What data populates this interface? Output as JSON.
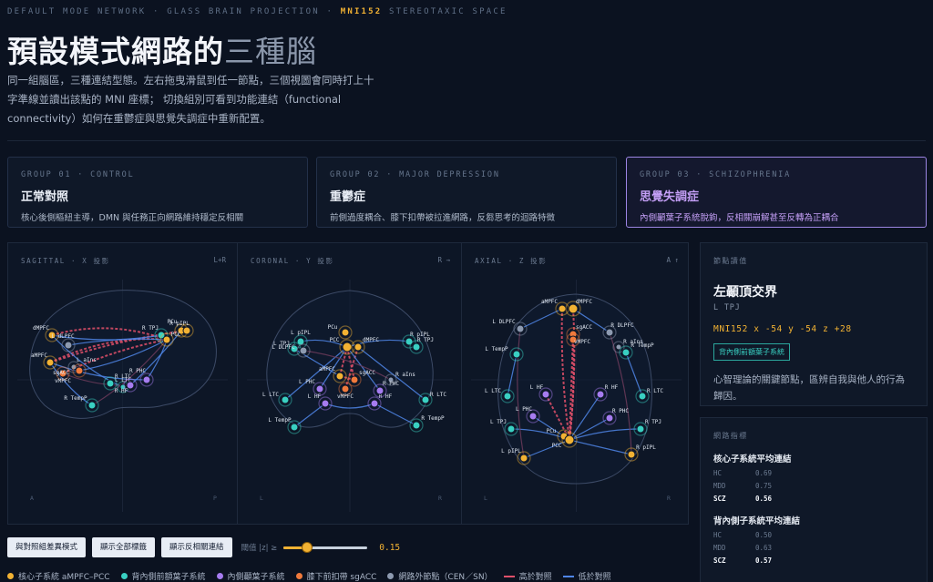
{
  "header": {
    "eyebrow_a": "DEFAULT MODE NETWORK · GLASS BRAIN PROJECTION ·",
    "eyebrow_hl": "MNI152",
    "eyebrow_b": "STEREOTAXIC SPACE",
    "title_strong": "預設模式網路的",
    "title_thin": "三種腦",
    "lede": "同一組腦區，三種連結型態。左右拖曳滑鼠到任一節點，三個視圖會同時打上十字準線並讀出該點的 MNI 座標； 切換組別可看到功能連結（functional connectivity）如何在重鬱症與思覺失調症中重新配置。"
  },
  "groups": [
    {
      "label": "GROUP 01 · CONTROL",
      "title": "正常對照",
      "desc": "核心後側樞紐主導，DMN 與任務正向網路維持穩定反相關"
    },
    {
      "label": "GROUP 02 · MAJOR DEPRESSION",
      "title": "重鬱症",
      "desc": "前側過度耦合、膝下扣帶被拉進網路，反芻思考的迴路特徵"
    },
    {
      "label": "GROUP 03 · SCHIZOPHRENIA",
      "title": "思覺失調症",
      "desc": "內側顳葉子系統脫鉤，反相關崩解甚至反轉為正耦合"
    }
  ],
  "views": [
    {
      "label": "SAGITTAL · X 投影",
      "dir": "L+R",
      "front": "A",
      "back": "P"
    },
    {
      "label": "CORONAL · Y 投影",
      "dir": "R →",
      "front": "L",
      "back": "R"
    },
    {
      "label": "AXIAL · Z 投影",
      "dir": "A ↑",
      "front": "L",
      "back": "R"
    }
  ],
  "node_panel": {
    "label": "節點讀值",
    "name": "左顳頂交界",
    "abbr": "L TPJ",
    "coord": "MNI152 x -54 y -54 z +28",
    "tag": "背內側前額葉子系統",
    "desc": "心智理論的關鍵節點，區辨自我與他人的行為歸因。"
  },
  "metrics": {
    "label": "網路指標",
    "blocks": [
      {
        "title": "核心子系統平均連結",
        "rows": [
          {
            "k": "HC",
            "v": "0.69"
          },
          {
            "k": "MDD",
            "v": "0.75"
          },
          {
            "k": "SCZ",
            "v": "0.56"
          }
        ]
      },
      {
        "title": "背內側子系統平均連結",
        "rows": [
          {
            "k": "HC",
            "v": "0.50"
          },
          {
            "k": "MDD",
            "v": "0.63"
          },
          {
            "k": "SCZ",
            "v": "0.57"
          }
        ]
      }
    ]
  },
  "controls": {
    "diff_button": "與對照組差異模式",
    "labels_button": "顯示全部標籤",
    "anticorr_button": "顯示反相關連結",
    "threshold_label": "閾值 |z| ≥",
    "threshold_value": "0.15",
    "threshold_fraction": 0.28
  },
  "legend": [
    {
      "label": "核心子系統 aMPFC–PCC",
      "color": "#f2b233",
      "kind": "dot"
    },
    {
      "label": "背內側前額葉子系統",
      "color": "#39d0c2",
      "kind": "dot"
    },
    {
      "label": "內側顳葉子系統",
      "color": "#a67cf0",
      "kind": "dot"
    },
    {
      "label": "膝下前扣帶 sgACC",
      "color": "#f07a3c",
      "kind": "dot"
    },
    {
      "label": "網路外節點（CEN／SN）",
      "color": "#8d9ab0",
      "kind": "dot"
    },
    {
      "label": "高於對照",
      "color": "#e0506a",
      "kind": "line"
    },
    {
      "label": "低於對照",
      "color": "#4f86e8",
      "kind": "line"
    }
  ],
  "node_labels": {
    "sagittal": [
      "dMPFC",
      "aMPFC",
      "PCu",
      "R pIPL",
      "R TPJ",
      "PCC",
      "vMPFC",
      "L aIns",
      "R PHC",
      "L LTC",
      "R HF",
      "R TempP",
      "R LTC",
      "sgACC",
      "L dLPFC"
    ],
    "coronal": [
      "L pIPL",
      "L TPJ",
      "L DLPFC",
      "PCu",
      "PCC",
      "dMPFC",
      "R pIPL",
      "R TPJ",
      "aMPFC",
      "sgACC",
      "vMPFC",
      "R aIns",
      "L PHC",
      "L LTC",
      "L HF",
      "R HF",
      "R PHC",
      "R LTC",
      "L TempP",
      "R TempP"
    ],
    "axial": [
      "aMPFC",
      "dMPFC",
      "R DLPFC",
      "L DLPFC",
      "sgACC",
      "vMPFC",
      "R aIns",
      "L TempP",
      "R TempP",
      "L LTC",
      "L HF",
      "R HF",
      "R LTC",
      "L PHC",
      "R PHC",
      "PCu",
      "PCC",
      "L TPJ",
      "R TPJ",
      "L pIPL",
      "R pIPL"
    ]
  }
}
